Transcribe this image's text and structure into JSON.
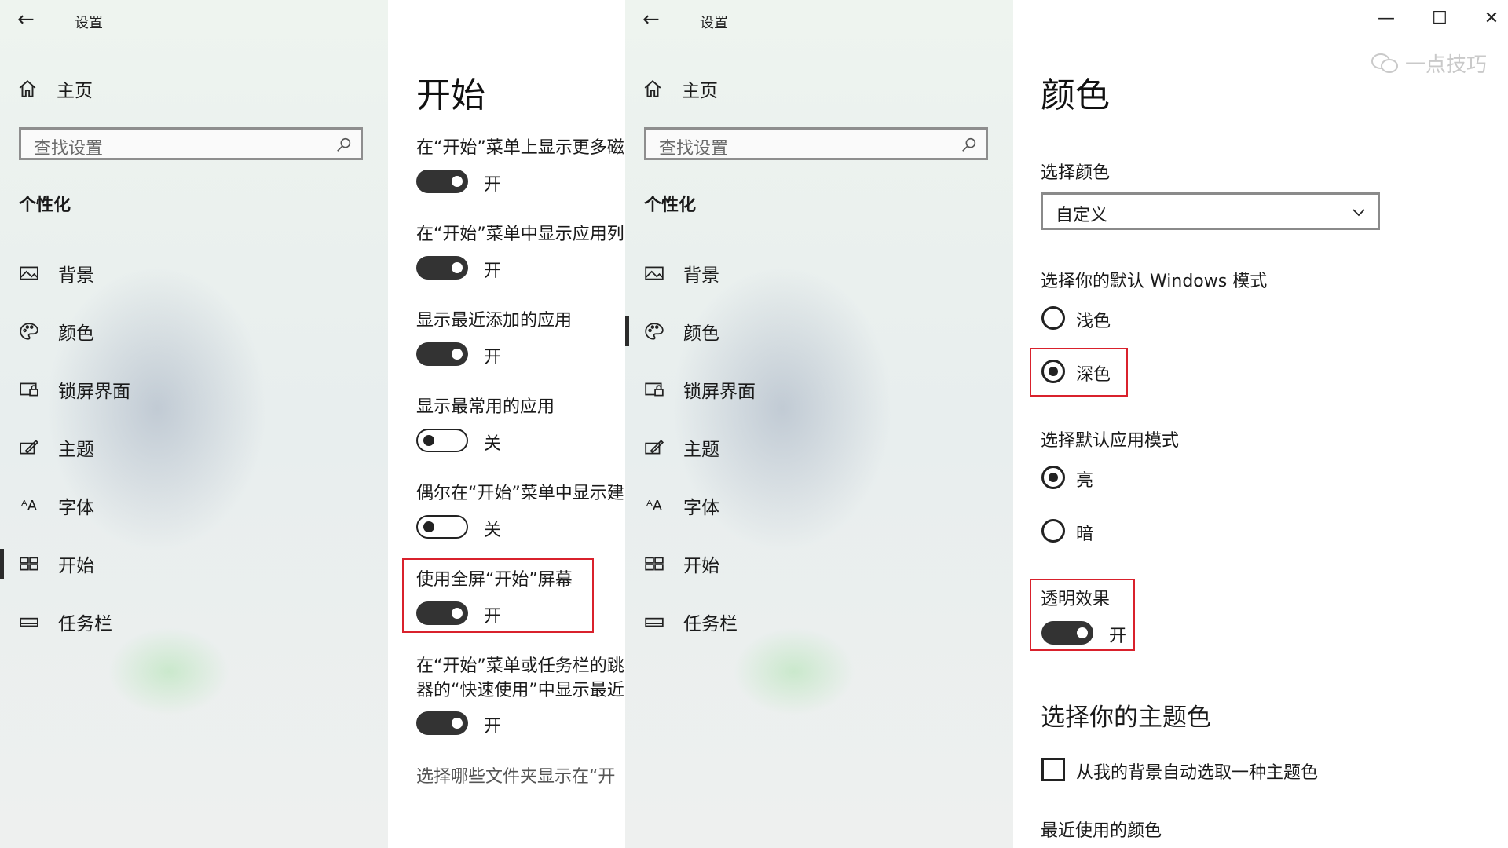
{
  "window": {
    "title": "设置",
    "minimize_glyph": "—",
    "maximize_glyph": "☐",
    "close_glyph": "✕"
  },
  "sidebar": {
    "home_label": "主页",
    "search_placeholder": "查找设置",
    "section_title": "个性化",
    "items": [
      {
        "label": "背景",
        "icon": "picture-icon"
      },
      {
        "label": "颜色",
        "icon": "palette-icon"
      },
      {
        "label": "锁屏界面",
        "icon": "lock-screen-icon"
      },
      {
        "label": "主题",
        "icon": "theme-icon"
      },
      {
        "label": "字体",
        "icon": "font-icon"
      },
      {
        "label": "开始",
        "icon": "start-icon"
      },
      {
        "label": "任务栏",
        "icon": "taskbar-icon"
      }
    ],
    "left_active_item": "开始"
  },
  "start_page": {
    "title": "开始",
    "settings": [
      {
        "label": "在“开始”菜单上显示更多磁",
        "state": "开",
        "on": true
      },
      {
        "label": "在“开始”菜单中显示应用列",
        "state": "开",
        "on": true
      },
      {
        "label": "显示最近添加的应用",
        "state": "开",
        "on": true
      },
      {
        "label": "显示最常用的应用",
        "state": "关",
        "on": false
      },
      {
        "label": "偶尔在“开始”菜单中显示建",
        "state": "关",
        "on": false
      },
      {
        "label": "使用全屏“开始”屏幕",
        "state": "开",
        "on": true
      },
      {
        "label_line1": "在“开始”菜单或任务栏的跳",
        "label_line2": "器的“快速使用”中显示最近",
        "state": "开",
        "on": true
      }
    ],
    "folders_link": "选择哪些文件夹显示在“开"
  },
  "color_page": {
    "title": "颜色",
    "choose_color_label": "选择颜色",
    "choose_color_value": "自定义",
    "windows_mode_label": "选择你的默认 Windows 模式",
    "windows_mode_options": [
      "浅色",
      "深色"
    ],
    "windows_mode_selected": "深色",
    "app_mode_label": "选择默认应用模式",
    "app_mode_options": [
      "亮",
      "暗"
    ],
    "app_mode_selected": "亮",
    "transparency_label": "透明效果",
    "transparency_state": "开",
    "accent_heading": "选择你的主题色",
    "auto_accent_label": "从我的背景自动选取一种主题色",
    "recent_colors_label": "最近使用的颜色"
  },
  "watermark": {
    "text": "一点技巧"
  },
  "colors": {
    "highlight": "#d9212c",
    "toggle_on": "#333333"
  }
}
